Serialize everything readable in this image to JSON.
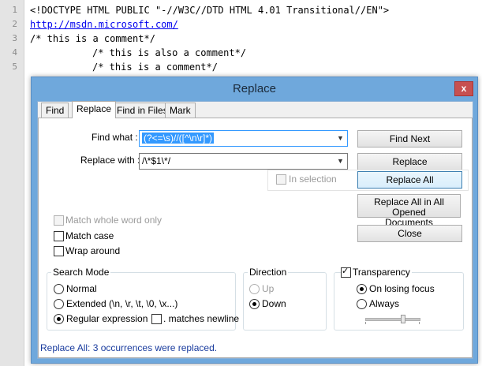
{
  "editor": {
    "lines": [
      {
        "num": "1",
        "text": "<!DOCTYPE HTML PUBLIC \"-//W3C//DTD HTML 4.01 Transitional//EN\">"
      },
      {
        "num": "2",
        "text": "http://msdn.microsoft.com/"
      },
      {
        "num": "3",
        "text": "/* this is a comment*/"
      },
      {
        "num": "4",
        "text": "/* this is also a comment*/"
      },
      {
        "num": "5",
        "text": "/* this is a comment*/"
      }
    ]
  },
  "dialog": {
    "title": "Replace",
    "close_glyph": "x",
    "tabs": [
      "Find",
      "Replace",
      "Find in Files",
      "Mark"
    ],
    "active_tab": "Replace",
    "find_what_label": "Find what :",
    "find_what_value": "(?<=\\s)//([^\\n\\r]*)",
    "replace_with_label": "Replace with :",
    "replace_with_value": "/\\*$1\\*/",
    "dropdown_arrow": "▼",
    "buttons": {
      "find_next": "Find Next",
      "replace": "Replace",
      "replace_all": "Replace All",
      "replace_all_opened_line1": "Replace All in All Opened",
      "replace_all_opened_line2": "Documents",
      "close": "Close"
    },
    "in_selection": {
      "label": "In selection",
      "checked": false,
      "enabled": false
    },
    "options": {
      "match_whole_word": {
        "label": "Match whole word only",
        "checked": false,
        "enabled": false
      },
      "match_case": {
        "label": "Match case",
        "checked": false
      },
      "wrap_around": {
        "label": "Wrap around",
        "checked": false
      }
    },
    "search_mode": {
      "title": "Search Mode",
      "normal": "Normal",
      "extended": "Extended (\\n, \\r, \\t, \\0, \\x...)",
      "regex": "Regular expression",
      "matches_newline": ". matches newline",
      "selected": "regex"
    },
    "direction": {
      "title": "Direction",
      "up": "Up",
      "down": "Down",
      "selected": "down"
    },
    "transparency": {
      "title": "Transparency",
      "checked": true,
      "on_losing_focus": "On losing focus",
      "always": "Always",
      "selected": "on_losing_focus",
      "level": 0.7
    },
    "status": "Replace All: 3 occurrences were replaced."
  }
}
